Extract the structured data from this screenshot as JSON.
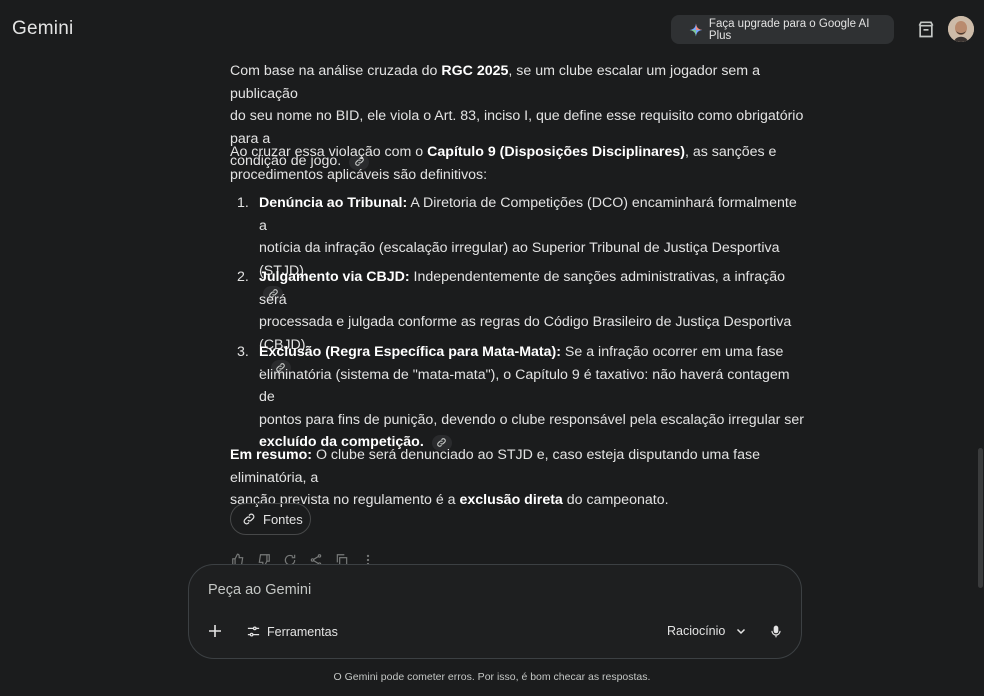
{
  "app": {
    "name": "Gemini"
  },
  "header": {
    "upgrade_label": "Faça upgrade para o Google AI Plus"
  },
  "response": {
    "p1_a": "Com base na análise cruzada do ",
    "p1_b": "RGC 2025",
    "p1_c": ", se um clube escalar um jogador sem a publicação",
    "p1_d": "do seu nome no BID, ele viola o Art. 83, inciso I, que define esse requisito como obrigatório para a",
    "p1_e": "condição de jogo.",
    "p2_a": "Ao cruzar essa violação com o ",
    "p2_b": "Capítulo 9 (Disposições Disciplinares)",
    "p2_c": ", as sanções e",
    "p2_d": "procedimentos aplicáveis são definitivos:",
    "items": [
      {
        "num": "1.",
        "title": "Denúncia ao Tribunal:",
        "line1": " A Diretoria de Competições (DCO) encaminhará formalmente a",
        "line2": "notícia da infração (escalação irregular) ao Superior Tribunal de Justiça Desportiva (STJD)."
      },
      {
        "num": "2.",
        "title": "Julgamento via CBJD:",
        "line1": " Independentemente de sanções administrativas, a infração será",
        "line2": "processada e julgada conforme as regras do Código Brasileiro de Justiça Desportiva (CBJD)",
        "line3": "."
      },
      {
        "num": "3.",
        "title": "Exclusão (Regra Específica para Mata-Mata):",
        "line1": " Se a infração ocorrer em uma fase",
        "line2": "eliminatória (sistema de \"mata-mata\"), o Capítulo 9 é taxativo: não haverá contagem de",
        "line3": "pontos para fins de punição, devendo o clube responsável pela escalação irregular ser",
        "line4": "excluído da competição."
      }
    ],
    "p3_a": "Em resumo:",
    "p3_b": " O clube será denunciado ao STJD e, caso esteja disputando uma fase eliminatória, a",
    "p3_c": "sanção prevista no regulamento é a ",
    "p3_d": "exclusão direta",
    "p3_e": " do campeonato."
  },
  "sources_button": "Fontes",
  "composer": {
    "placeholder": "Peça ao Gemini",
    "tools_label": "Ferramentas",
    "mode_label": "Raciocínio"
  },
  "disclaimer": "O Gemini pode cometer erros. Por isso, é bom checar as respostas.",
  "colors": {
    "background": "#1b1c1d",
    "text": "#e3e3e3",
    "button": "#2f3133"
  }
}
